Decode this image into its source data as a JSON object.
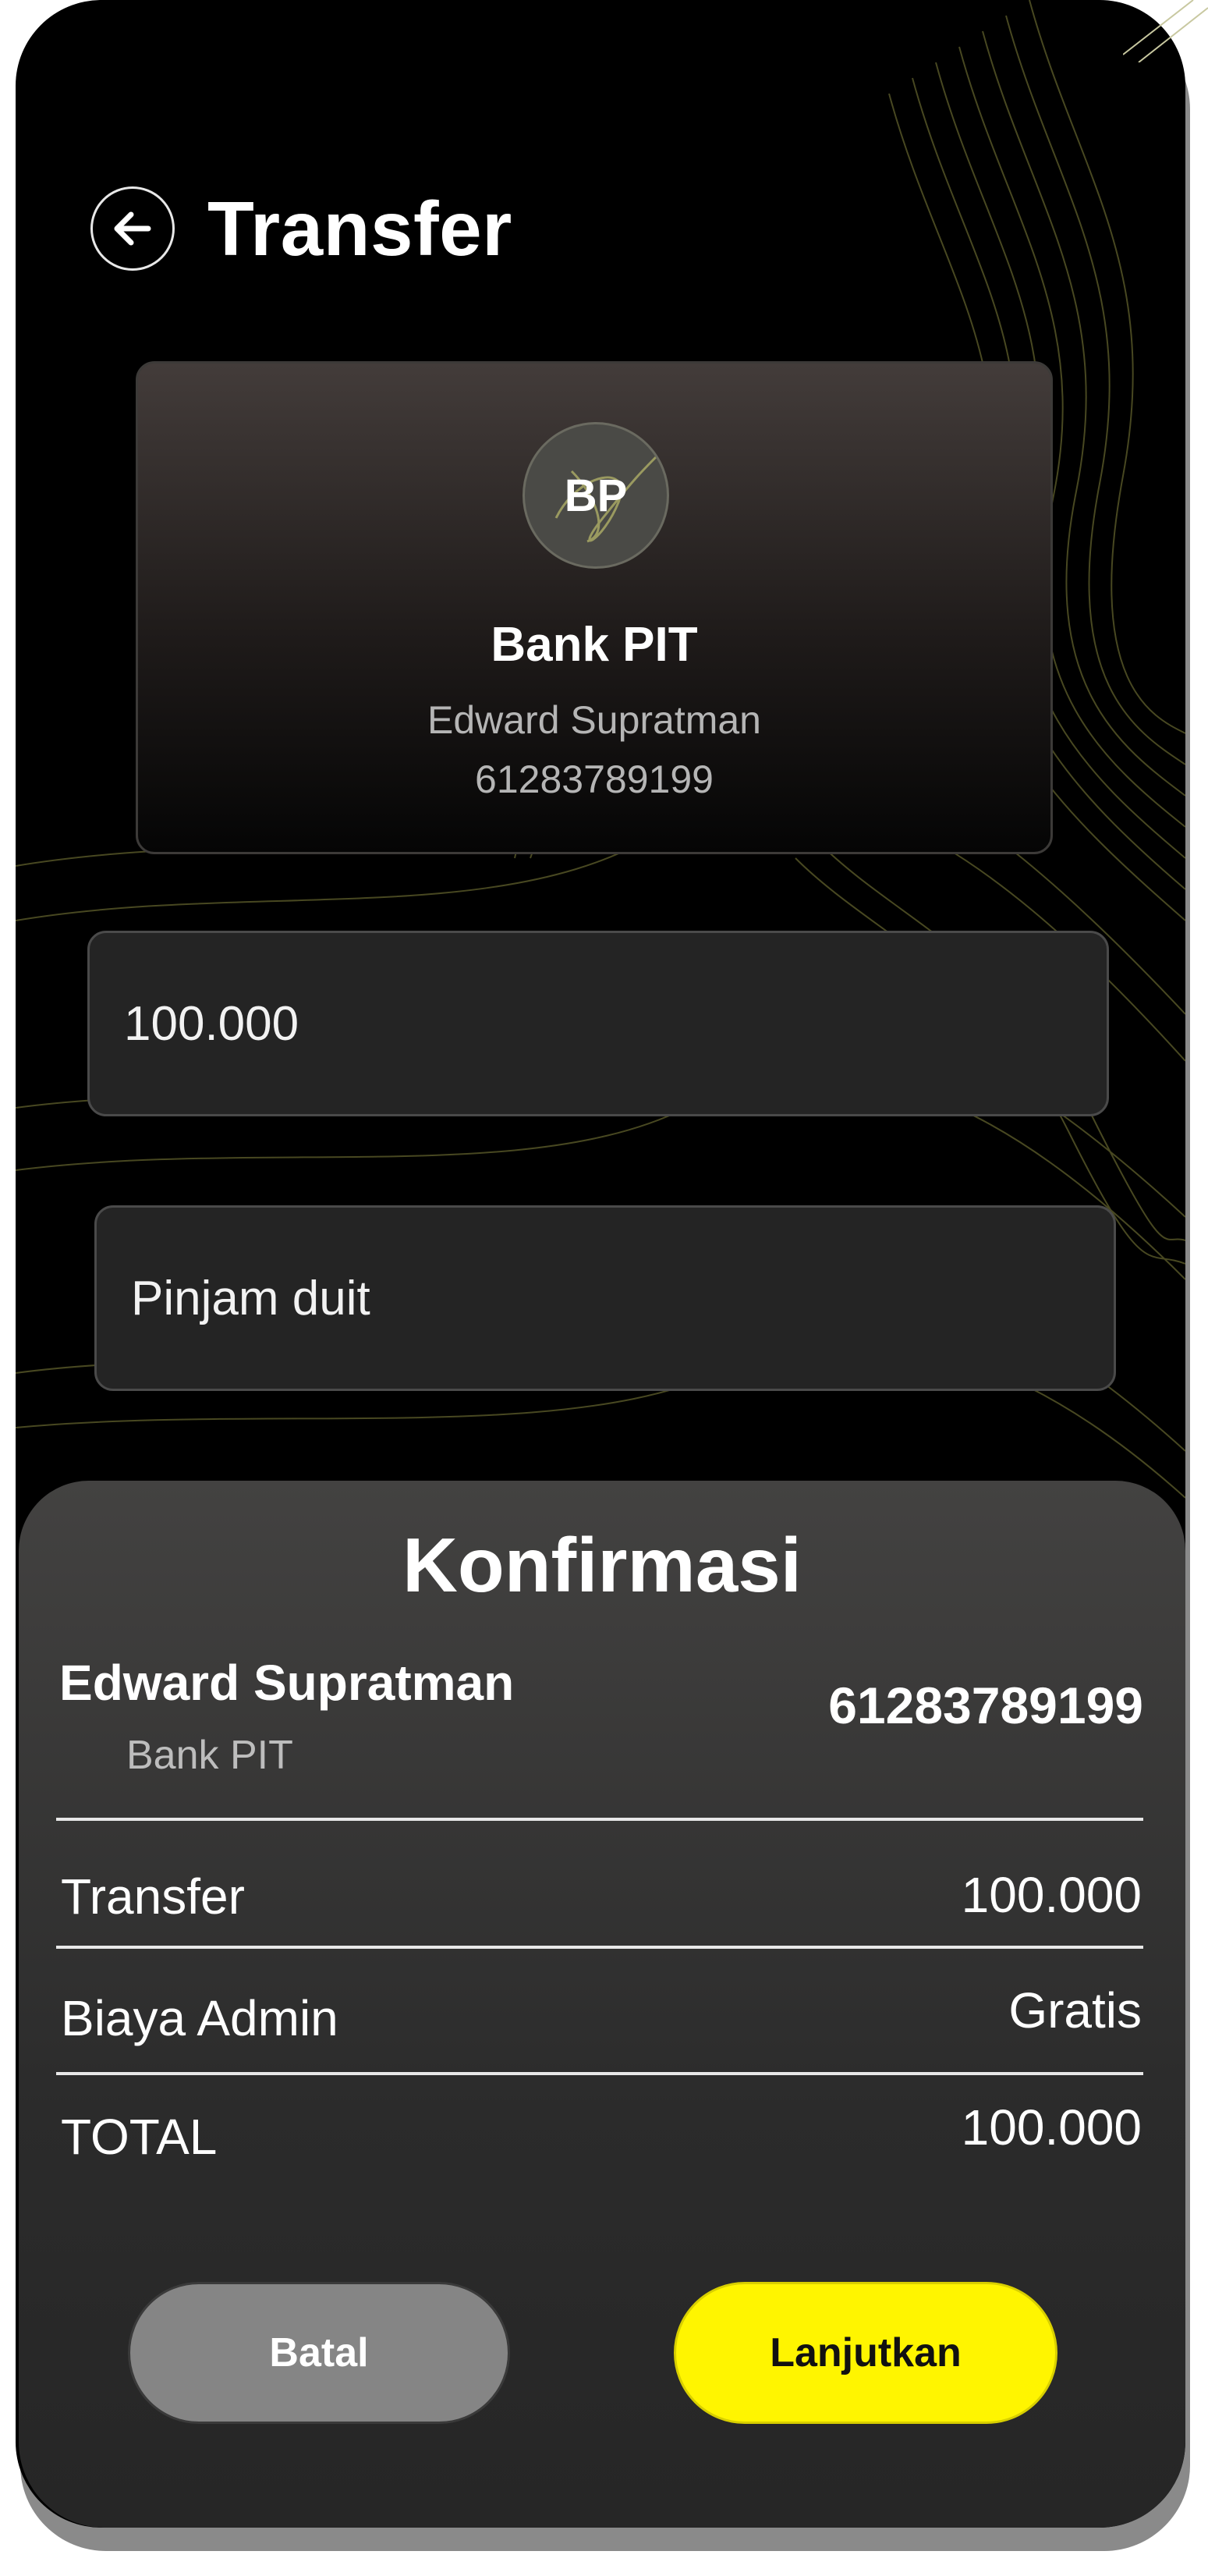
{
  "header": {
    "title": "Transfer"
  },
  "recipient_card": {
    "bank_initials": "BP",
    "bank_name": "Bank PIT",
    "account_holder": "Edward Supratman",
    "account_number": "61283789199"
  },
  "form": {
    "amount_value": "100.000",
    "note_value": "Pinjam duit"
  },
  "confirmation": {
    "title": "Konfirmasi",
    "recipient_name": "Edward Supratman",
    "recipient_bank": "Bank PIT",
    "recipient_account": "61283789199",
    "rows": [
      {
        "label": "Transfer",
        "value": "100.000"
      },
      {
        "label": "Biaya Admin",
        "value": "Gratis"
      },
      {
        "label": "TOTAL",
        "value": "100.000"
      }
    ],
    "cancel_label": "Batal",
    "continue_label": "Lanjutkan"
  },
  "colors": {
    "accent": "#FFF500",
    "background": "#000000",
    "sheet": "#3A3A3A",
    "cancel_button": "#858585"
  },
  "icons": {
    "back": "arrow-left-icon"
  }
}
